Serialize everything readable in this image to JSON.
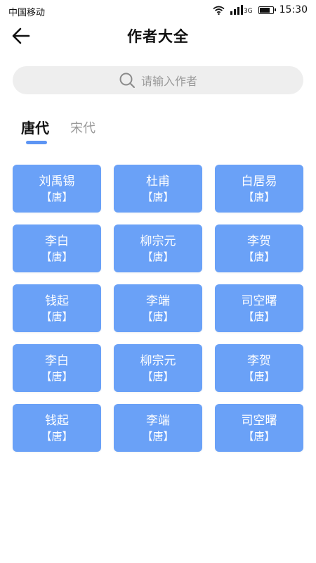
{
  "status_bar": {
    "carrier": "中国移动",
    "network": "3G",
    "time": "15:30"
  },
  "header": {
    "title": "作者大全"
  },
  "search": {
    "placeholder": "请输入作者"
  },
  "tabs": [
    {
      "label": "唐代",
      "active": true
    },
    {
      "label": "宋代",
      "active": false
    }
  ],
  "colors": {
    "card": "#6aa1f7",
    "accent": "#5d95f4",
    "search_bg": "#eeeeee"
  },
  "authors": [
    {
      "name": "刘禹锡",
      "dynasty": "【唐】"
    },
    {
      "name": "杜甫",
      "dynasty": "【唐】"
    },
    {
      "name": "白居易",
      "dynasty": "【唐】"
    },
    {
      "name": "李白",
      "dynasty": "【唐】"
    },
    {
      "name": "柳宗元",
      "dynasty": "【唐】"
    },
    {
      "name": "李贺",
      "dynasty": "【唐】"
    },
    {
      "name": "钱起",
      "dynasty": "【唐】"
    },
    {
      "name": "李端",
      "dynasty": "【唐】"
    },
    {
      "name": "司空曙",
      "dynasty": "【唐】"
    },
    {
      "name": "李白",
      "dynasty": "【唐】"
    },
    {
      "name": "柳宗元",
      "dynasty": "【唐】"
    },
    {
      "name": "李贺",
      "dynasty": "【唐】"
    },
    {
      "name": "钱起",
      "dynasty": "【唐】"
    },
    {
      "name": "李端",
      "dynasty": "【唐】"
    },
    {
      "name": "司空曙",
      "dynasty": "【唐】"
    }
  ]
}
